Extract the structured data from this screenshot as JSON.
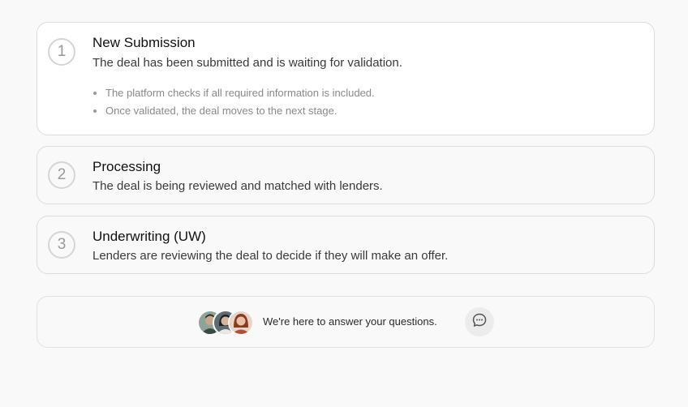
{
  "steps": [
    {
      "number": "1",
      "title": "New Submission",
      "description": "The deal has been submitted and is waiting for validation.",
      "details": [
        "The platform checks if all required information is included.",
        "Once validated, the deal moves to the next stage."
      ],
      "state": "active"
    },
    {
      "number": "2",
      "title": "Processing",
      "description": "The deal is being reviewed and matched with lenders.",
      "state": "upcoming"
    },
    {
      "number": "3",
      "title": "Underwriting (UW)",
      "description": "Lenders are reviewing the deal to decide if they will make an offer.",
      "state": "upcoming"
    }
  ],
  "support": {
    "text": "We're here to answer your questions.",
    "avatars": [
      "support-agent-1",
      "support-agent-2",
      "support-agent-3"
    ],
    "chat_icon": "chat-bubble-icon"
  },
  "colors": {
    "background": "#f9f9f9",
    "active_card": "#ffffff",
    "border": "#dcdcdc",
    "number_ring": "#d5d5d5"
  }
}
